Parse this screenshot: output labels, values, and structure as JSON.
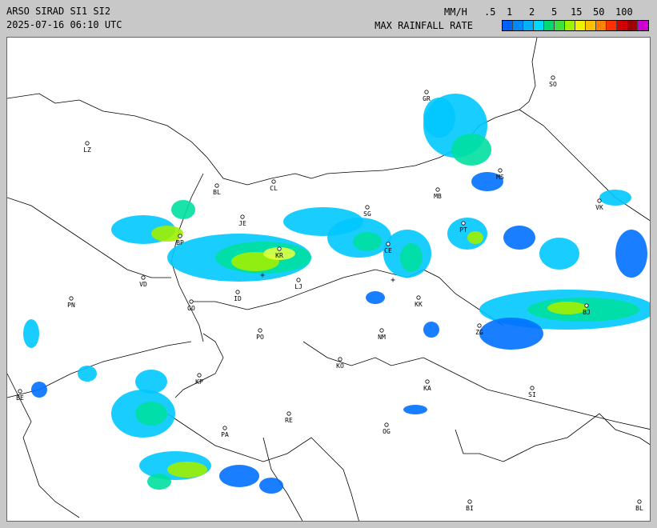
{
  "header": {
    "line1": "ARSO SIRAD SI1 SI2",
    "line2": "2025-07-16 06:10 UTC",
    "units": "MM/H",
    "scale": [
      ".5",
      "1",
      "2",
      "5",
      "15",
      "50",
      "100"
    ],
    "legend_title": "MAX RAINFALL RATE",
    "legend_colors": [
      "#0060ff",
      "#0088ff",
      "#00b0ff",
      "#00d8ff",
      "#00d870",
      "#40e040",
      "#a0f000",
      "#f0f000",
      "#ffc000",
      "#ff8000",
      "#ff3000",
      "#d00000",
      "#a00000",
      "#d000d0"
    ]
  },
  "map": {
    "cities": [
      {
        "code": "GR"
      },
      {
        "code": "SO"
      },
      {
        "code": "LZ"
      },
      {
        "code": "BL"
      },
      {
        "code": "CL"
      },
      {
        "code": "MB"
      },
      {
        "code": "MS"
      },
      {
        "code": "VK"
      },
      {
        "code": "JE"
      },
      {
        "code": "KR"
      },
      {
        "code": "SG"
      },
      {
        "code": "PT"
      },
      {
        "code": "BP"
      },
      {
        "code": "CE"
      },
      {
        "code": "VD"
      },
      {
        "code": "LJ"
      },
      {
        "code": "PN"
      },
      {
        "code": "GO"
      },
      {
        "code": "ID"
      },
      {
        "code": "KK"
      },
      {
        "code": "BJ"
      },
      {
        "code": "PO"
      },
      {
        "code": "NM"
      },
      {
        "code": "ZG"
      },
      {
        "code": "KO"
      },
      {
        "code": "KP"
      },
      {
        "code": "KA"
      },
      {
        "code": "SI"
      },
      {
        "code": "RE"
      },
      {
        "code": "PA"
      },
      {
        "code": "OG"
      },
      {
        "code": "BI"
      },
      {
        "code": "BL"
      },
      {
        "code": "BE"
      }
    ],
    "colors": {
      "light": "#00c8ff",
      "medium": "#00e0a0",
      "heavy": "#a0f000",
      "strong": "#e0ff40",
      "blue": "#0070ff"
    }
  }
}
